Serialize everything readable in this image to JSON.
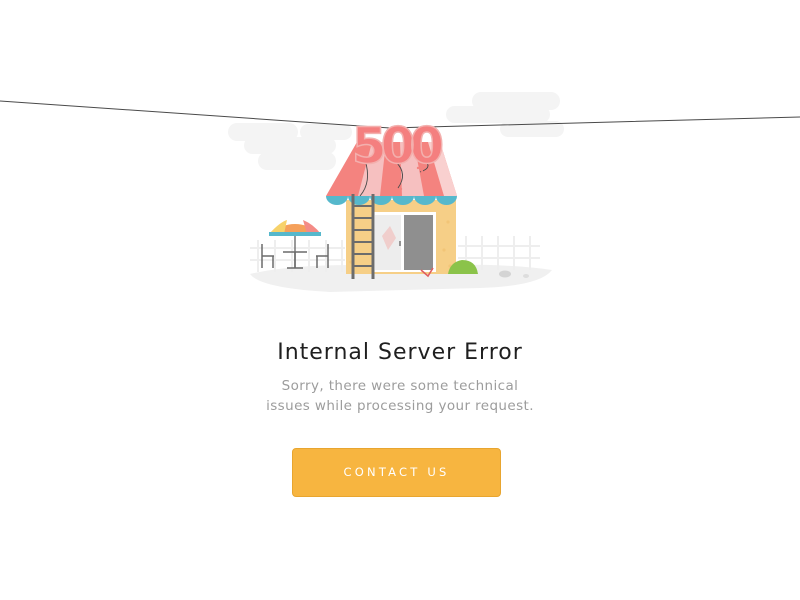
{
  "illustration": {
    "balloon_text": "500",
    "colors": {
      "awning_red": "#f4837f",
      "awning_pink": "#f6c0c0",
      "awning_trim": "#56b8cc",
      "wall": "#f6cf87",
      "door_glass": "#e9e9e9",
      "ground": "#f1f1f1",
      "cloud": "#f5f5f5"
    }
  },
  "error": {
    "title": "Internal Server Error",
    "message_line1": "Sorry, there were some technical",
    "message_line2": "issues while processing your request."
  },
  "actions": {
    "contact_label": "CONTACT US",
    "contact_color": "#f7b540"
  }
}
